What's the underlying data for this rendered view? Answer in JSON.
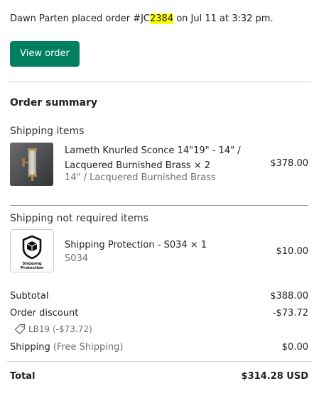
{
  "intro": {
    "prefix": "Dawn Parten placed order #JC",
    "order_highlight": "2384",
    "suffix": " on Jul 11 at 3:32 pm."
  },
  "view_order_label": "View order",
  "summary_title": "Order summary",
  "shipping_items": {
    "heading": "Shipping items",
    "items": [
      {
        "title_line1": "Lameth Knurled Sconce 14\"19\" - 14\" /",
        "title_line2": "Lacquered Burnished Brass × 2",
        "variant": "14\" / Lacquered Burnished Brass",
        "price": "$378.00",
        "thumb_icon": "wall-sconce-photo"
      }
    ]
  },
  "not_required_items": {
    "heading": "Shipping not required items",
    "items": [
      {
        "title": "Shipping Protection - S034 × 1",
        "variant": "S034",
        "price": "$10.00",
        "thumb_icon": "shipping-protection-badge",
        "thumb_text_line1": "Shipping",
        "thumb_text_line2": "Protection"
      }
    ]
  },
  "totals": {
    "subtotal_label": "Subtotal",
    "subtotal_value": "$388.00",
    "discount_label": "Order discount",
    "discount_value": "-$73.72",
    "discount_code": "LB19 (-$73.72)",
    "shipping_label": "Shipping",
    "shipping_note": "(Free Shipping)",
    "shipping_value": "$0.00",
    "total_label": "Total",
    "total_value": "$314.28 USD"
  },
  "colors": {
    "primary_button": "#008060",
    "highlight": "#ffff00",
    "muted_text": "#6d7175"
  }
}
